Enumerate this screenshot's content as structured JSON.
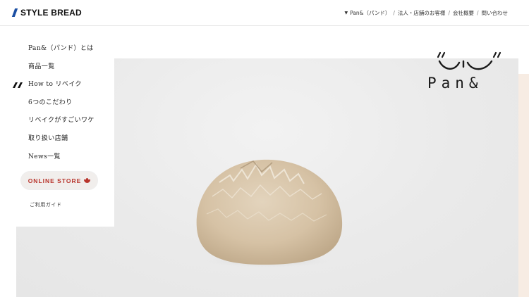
{
  "header": {
    "logo_text": "STYLE BREAD",
    "nav": [
      {
        "label": "Pan&（パンド）"
      },
      {
        "label": "法人・店舗のお客様"
      },
      {
        "label": "会社概要"
      },
      {
        "label": "問い合わせ"
      }
    ],
    "separator": "/"
  },
  "menu": {
    "items": [
      {
        "label": "Pan&（パンド）とは"
      },
      {
        "label": "商品一覧"
      },
      {
        "label": "How to リベイク"
      },
      {
        "label": "6つのこだわり"
      },
      {
        "label": "リベイクがすごいワケ"
      },
      {
        "label": "取り扱い店舗"
      },
      {
        "label": "News一覧"
      }
    ],
    "active_index": 2,
    "online_store_label": "ONLINE STORE",
    "guide_label": "ご利用ガイド"
  },
  "brand": {
    "name": "Pan&"
  },
  "colors": {
    "logo_blue": "#1b4fa3",
    "accent_red": "#b8342c",
    "hero_bg": "#ededed",
    "right_strip": "#f7ece3"
  },
  "icons": {
    "active_marker": "double-slash-icon",
    "online_store": "bowl-icon",
    "nav_marker": "triangle-down-icon"
  }
}
